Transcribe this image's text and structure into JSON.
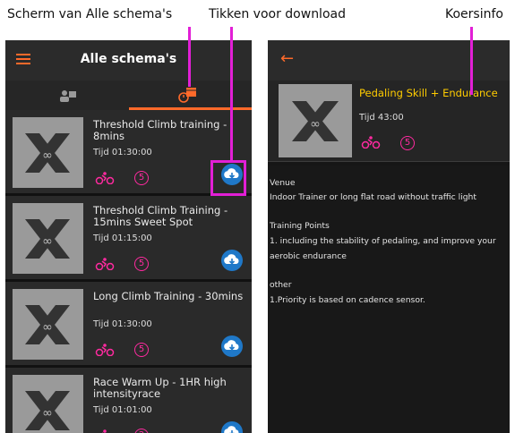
{
  "captions": {
    "left": "Scherm van Alle schema's",
    "middle": "Tikken voor download",
    "right": "Koersinfo"
  },
  "colors": {
    "accent": "#ff6a2a",
    "callout": "#e21fd6",
    "title_yellow": "#ffcc00",
    "download_blue": "#1f78c8",
    "bike_pink": "#ff2aa0"
  },
  "left_screen": {
    "title": "Alle schema's",
    "menu_icon": "hamburger-menu-icon",
    "tabs": [
      {
        "icon": "profile-icon",
        "active": false
      },
      {
        "icon": "calendar-icon",
        "active": true
      }
    ],
    "items": [
      {
        "title": "Threshold Climb training - 8mins",
        "time": "Tijd  01:30:00",
        "level": "5"
      },
      {
        "title": "Threshold Climb Training - 15mins Sweet Spot",
        "time": "Tijd  01:15:00",
        "level": "5"
      },
      {
        "title": "Long Climb Training - 30mins",
        "time": "Tijd  01:30:00",
        "level": "5"
      },
      {
        "title": "Race Warm Up - 1HR high intensityrace",
        "time": "Tijd  01:01:00",
        "level": "2"
      }
    ]
  },
  "right_screen": {
    "back_icon": "back-arrow-icon",
    "title": "Pedaling Skill + Endurance",
    "time": "Tijd  43:00",
    "level": "5",
    "lines": [
      "Venue",
      "Indoor Trainer or long flat road without traffic light",
      "Training Points",
      "1.  including the stability of pedaling, and improve your",
      "aerobic endurance",
      "other",
      "1.Priority is based on cadence sensor."
    ]
  }
}
